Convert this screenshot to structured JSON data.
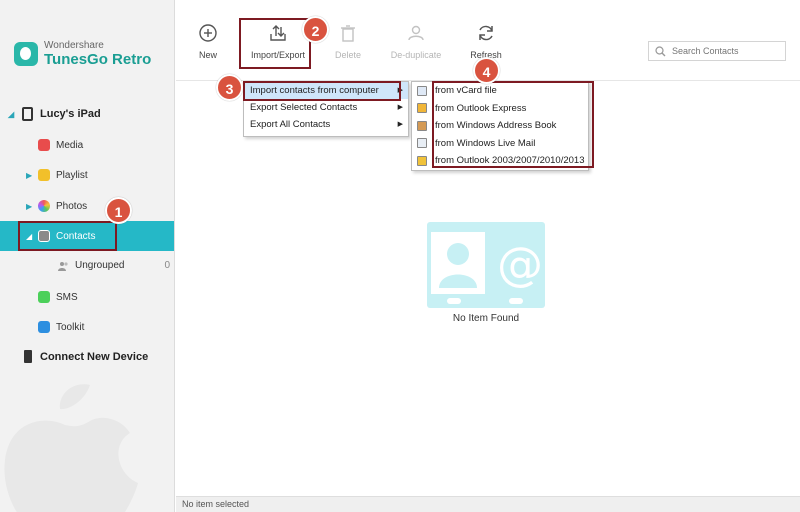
{
  "app": {
    "brand": "Wondershare",
    "product": "TunesGo Retro",
    "accent": "#25b8c7"
  },
  "sidebar": {
    "device_name": "Lucy's iPad",
    "items": [
      {
        "label": "Media",
        "icon": "media-icon",
        "expandable": false
      },
      {
        "label": "Playlist",
        "icon": "playlist-icon",
        "expandable": true
      },
      {
        "label": "Photos",
        "icon": "photos-icon",
        "expandable": true
      },
      {
        "label": "Contacts",
        "icon": "contacts-icon",
        "expandable": true,
        "active": true
      },
      {
        "label": "SMS",
        "icon": "sms-icon",
        "expandable": false
      },
      {
        "label": "Toolkit",
        "icon": "toolkit-icon",
        "expandable": false
      }
    ],
    "sub_item": {
      "label": "Ungrouped",
      "count": "0"
    },
    "connect_label": "Connect New Device"
  },
  "toolbar": {
    "new_label": "New",
    "import_export_label": "Import/Export",
    "delete_label": "Delete",
    "dedup_label": "De-duplicate",
    "refresh_label": "Refresh",
    "search_placeholder": "Search Contacts"
  },
  "menu": {
    "items": [
      "Import contacts from computer",
      "Export Selected Contacts",
      "Export All Contacts"
    ],
    "submenu": [
      "from vCard file",
      "from Outlook Express",
      "from Windows Address Book",
      "from Windows Live Mail",
      "from Outlook 2003/2007/2010/2013"
    ]
  },
  "empty_state": {
    "label": "No Item Found"
  },
  "statusbar": {
    "text": "No item selected"
  },
  "annotations": {
    "badge1": "1",
    "badge2": "2",
    "badge3": "3",
    "badge4": "4",
    "color": "#d9533f"
  }
}
